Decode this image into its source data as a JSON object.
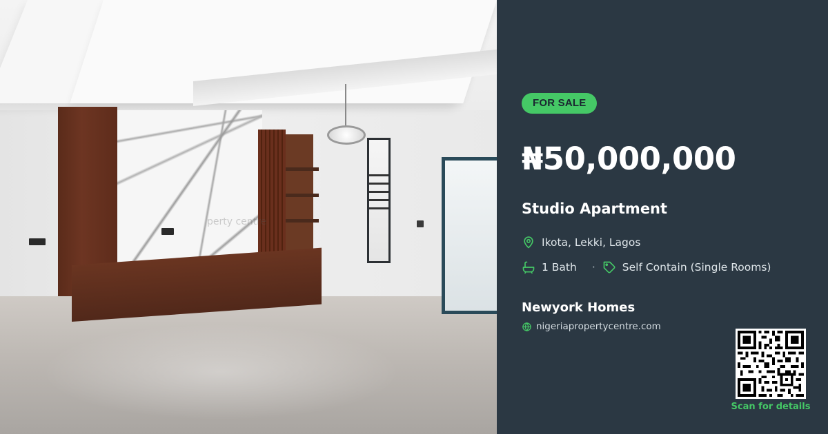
{
  "listing": {
    "status_badge": "FOR SALE",
    "price": "₦50,000,000",
    "title": "Studio Apartment",
    "location": "Ikota, Lekki, Lagos",
    "baths": "1 Bath",
    "separator": "·",
    "category": "Self Contain (Single Rooms)"
  },
  "agent": {
    "name": "Newyork Homes",
    "website": "nigeriapropertycentre.com"
  },
  "qr": {
    "caption": "Scan for details"
  },
  "photo": {
    "watermark": "perty centre"
  },
  "icons": {
    "location": "map-pin-icon",
    "bath": "bathtub-icon",
    "tag": "tag-icon",
    "web": "globe-icon"
  },
  "colors": {
    "panel_bg": "#2b3843",
    "accent": "#45c866",
    "text_primary": "#ffffff",
    "text_secondary": "#dfe6ea"
  }
}
